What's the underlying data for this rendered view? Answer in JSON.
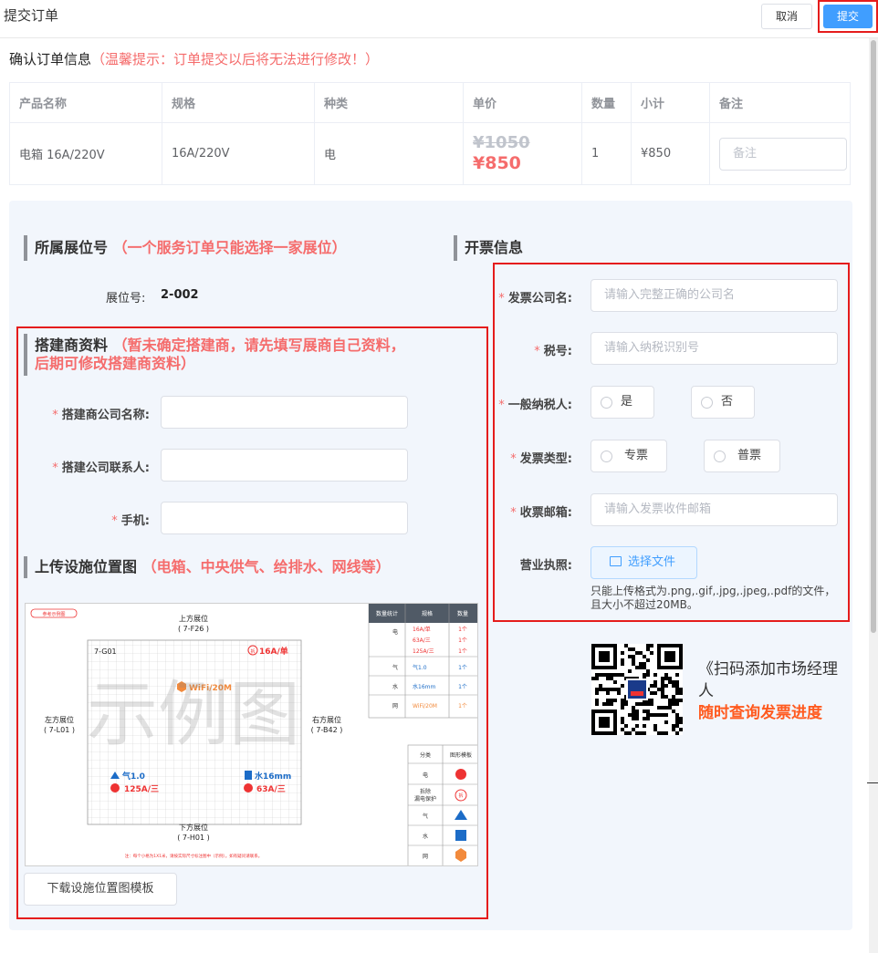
{
  "header": {
    "title": "提交订单",
    "cancel_label": "取消",
    "submit_label": "提交"
  },
  "confirm": {
    "title": "确认订单信息",
    "warning": "（温馨提示：订单提交以后将无法进行修改！）"
  },
  "order_table": {
    "columns": [
      "产品名称",
      "规格",
      "种类",
      "单价",
      "数量",
      "小计",
      "备注"
    ],
    "rows": [
      {
        "product": "电箱 16A/220V",
        "spec": "16A/220V",
        "category": "电",
        "original_price": "¥1050",
        "price": "¥850",
        "quantity": "1",
        "subtotal": "¥850",
        "remark_placeholder": "备注"
      }
    ]
  },
  "booth": {
    "title": "所属展位号",
    "hint": "（一个服务订单只能选择一家展位）",
    "label": "展位号:",
    "value": "2-002"
  },
  "builder": {
    "title": "搭建商资料",
    "hint_line1": "（暂未确定搭建商，请先填写展商自己资料，",
    "hint_line2": "后期可修改搭建商资料）",
    "fields": [
      {
        "label": "搭建商公司名称:",
        "value": ""
      },
      {
        "label": "搭建公司联系人:",
        "value": ""
      },
      {
        "label": "手机:",
        "value": ""
      }
    ]
  },
  "upload_layout": {
    "title": "上传设施位置图",
    "hint": "（电箱、中央供气、给排水、网线等）",
    "download_label": "下载设施位置图模板"
  },
  "diagram": {
    "tag": "参考示例图",
    "watermark": "示例图",
    "top_label": "上方展位",
    "top_code": "( 7-F26 )",
    "bottom_label": "下方展位",
    "bottom_code": "( 7-H01 )",
    "left_label": "左方展位",
    "left_code": "( 7-L01 )",
    "right_label": "右方展位",
    "right_code": "( 7-B42 )",
    "booth_code": "7-G01",
    "marker_16a": "16A/单",
    "marker_wifi": "WiFi/20M",
    "marker_gas": "气1.0",
    "marker_water": "水16mm",
    "marker_125a": "125A/三",
    "marker_63a": "63A/三",
    "footnote": "注：每个小格为1X1米，请按实际尺寸标注图中（示例）。如有疑问请联系。",
    "stats_headers": [
      "数量统计",
      "规格",
      "数量"
    ],
    "stats_rows": [
      {
        "cat": "电",
        "spec": "16A/单\n63A/三\n125A/三",
        "qty": "1个\n1个\n1个"
      },
      {
        "cat": "气",
        "spec": "气1.0",
        "qty": "1个"
      },
      {
        "cat": "水",
        "spec": "水16mm",
        "qty": "1个"
      },
      {
        "cat": "网",
        "spec": "WiFi/20M",
        "qty": "1个"
      }
    ],
    "legend_headers": [
      "分类",
      "图形模板"
    ],
    "legend_rows": [
      "电",
      "拆除\n漏电保护",
      "气",
      "水",
      "网"
    ],
    "legend_chai": "拆"
  },
  "invoice": {
    "title": "开票信息",
    "company_label": "发票公司名:",
    "company_placeholder": "请输入完整正确的公司名",
    "tax_label": "税号:",
    "tax_placeholder": "请输入纳税识别号",
    "general_taxpayer_label": "一般纳税人:",
    "general_taxpayer_options": [
      "是",
      "否"
    ],
    "type_label": "发票类型:",
    "type_options": [
      "专票",
      "普票"
    ],
    "email_label": "收票邮箱:",
    "email_placeholder": "请输入发票收件邮箱",
    "license_label": "营业执照:",
    "file_button": "选择文件",
    "upload_tip": "只能上传格式为.png,.gif,.jpg,.jpeg,.pdf的文件，且大小不超过20MB。"
  },
  "qr": {
    "text": "《扫码添加市场经理人",
    "highlight": "随时查询发票进度"
  },
  "colors": {
    "primary": "#409eff",
    "danger": "#f56c6c",
    "highlight_box": "#e51c1c",
    "qr_orange": "#ff5a1f"
  }
}
